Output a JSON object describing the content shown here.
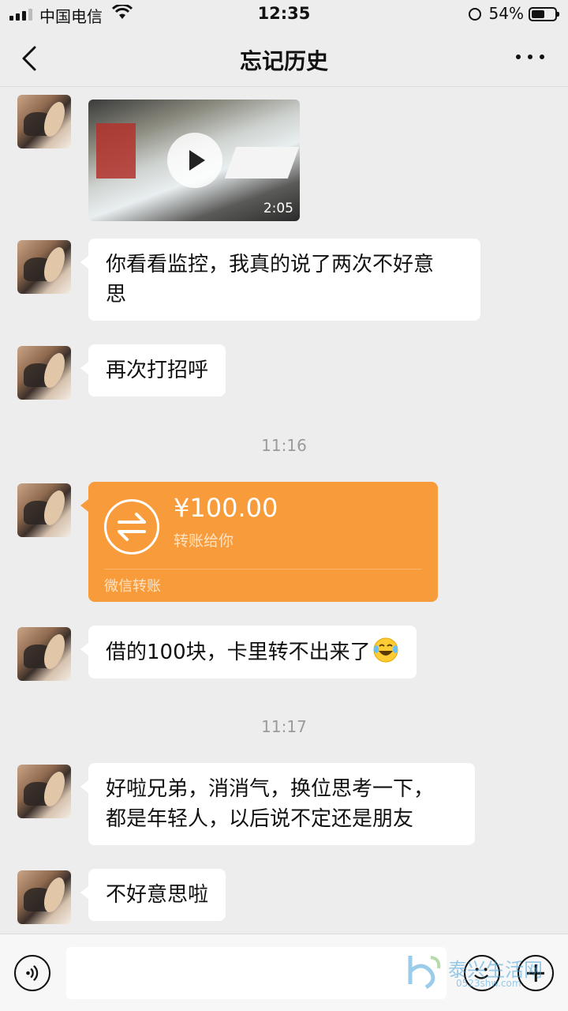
{
  "status_bar": {
    "carrier": "中国电信",
    "time": "12:35",
    "battery_percent": "54%"
  },
  "header": {
    "title": "忘记历史"
  },
  "messages": [
    {
      "type": "video",
      "duration": "2:05"
    },
    {
      "type": "text",
      "lines": [
        "你看看监控，我真的说了两次不好意",
        "思"
      ]
    },
    {
      "type": "text",
      "lines": [
        "再次打招呼"
      ]
    },
    {
      "type": "timestamp",
      "text": "11:16"
    },
    {
      "type": "transfer",
      "amount": "¥100.00",
      "subtitle": "转账给你",
      "footer": "微信转账"
    },
    {
      "type": "text",
      "lines": [
        "借的100块，卡里转不出来了"
      ],
      "emoji": "laughing-tears"
    },
    {
      "type": "timestamp",
      "text": "11:17"
    },
    {
      "type": "text",
      "lines": [
        "好啦兄弟，消消气，换位思考一下，",
        "都是年轻人，以后说不定还是朋友"
      ]
    },
    {
      "type": "text",
      "lines": [
        "不好意思啦"
      ]
    }
  ],
  "watermark": {
    "text": "泰兴生活网",
    "url": "0523shw.com"
  },
  "colors": {
    "background": "#ededed",
    "bubble": "#ffffff",
    "transfer": "#f89c3b",
    "timestamp": "#9a9a9a"
  },
  "icons": [
    "back-icon",
    "more-icon",
    "voice-icon",
    "emoji-icon",
    "plus-icon",
    "play-icon",
    "transfer-icon"
  ]
}
